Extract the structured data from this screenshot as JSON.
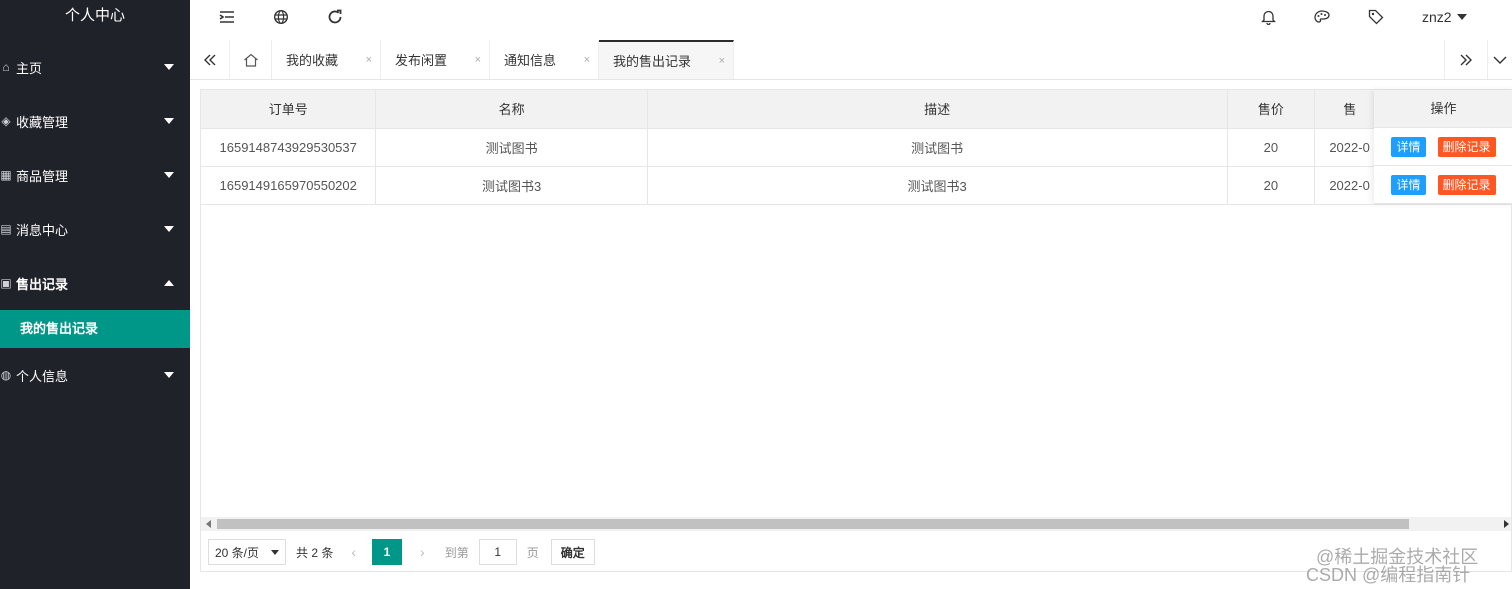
{
  "sidebar": {
    "title": "个人中心",
    "items": [
      {
        "label": "主页",
        "icon": "home-icon",
        "glyph": "⌂"
      },
      {
        "label": "收藏管理",
        "icon": "cube-icon",
        "glyph": "◈"
      },
      {
        "label": "商品管理",
        "icon": "goods-icon",
        "glyph": "▦"
      },
      {
        "label": "消息中心",
        "icon": "message-icon",
        "glyph": "▤"
      },
      {
        "label": "售出记录",
        "icon": "record-icon",
        "glyph": "▣"
      },
      {
        "label": "个人信息",
        "icon": "user-icon",
        "glyph": "◍"
      }
    ],
    "active_sub": "我的售出记录"
  },
  "header": {
    "user": "znz2"
  },
  "tabs": {
    "items": [
      {
        "label": "我的收藏"
      },
      {
        "label": "发布闲置"
      },
      {
        "label": "通知信息"
      },
      {
        "label": "我的售出记录"
      }
    ],
    "close_glyph": "×"
  },
  "table": {
    "columns": [
      "订单号",
      "名称",
      "描述",
      "售价",
      "售"
    ],
    "operation_header": "操作",
    "rows": [
      {
        "order": "1659148743929530537",
        "name": "测试图书",
        "desc": "测试图书",
        "price": "20",
        "date": "2022-0"
      },
      {
        "order": "1659149165970550202",
        "name": "测试图书3",
        "desc": "测试图书3",
        "price": "20",
        "date": "2022-0"
      }
    ],
    "detail_label": "详情",
    "delete_label": "删除记录"
  },
  "pager": {
    "page_size": "20 条/页",
    "total": "共 2 条",
    "current": "1",
    "goto_label": "到第",
    "goto_value": "1",
    "unit": "页",
    "confirm": "确定",
    "prev": "‹",
    "next": "›"
  },
  "watermark": {
    "line1": "@稀土掘金技术社区",
    "line2": "CSDN @编程指南针"
  },
  "colors": {
    "sidebar_bg": "#20222a",
    "accent": "#009688",
    "detail_btn": "#1e9fff",
    "delete_btn": "#ff5722"
  }
}
